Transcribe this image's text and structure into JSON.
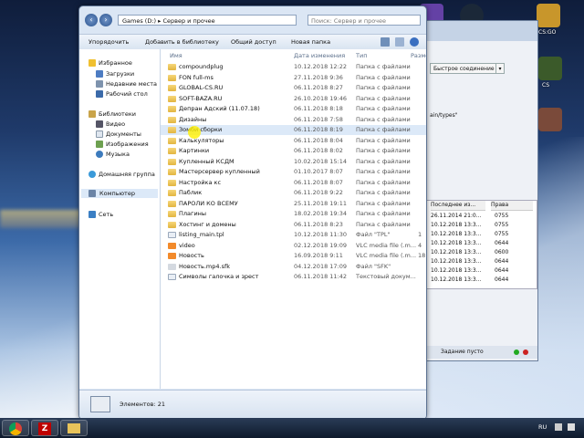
{
  "desktop": {
    "top_icons": [
      "twitch",
      "steam",
      "csgo"
    ],
    "icon_labels": [
      "CS:GO",
      "CS"
    ]
  },
  "explorer": {
    "breadcrumb": [
      "Games (D:)",
      "Сервер и прочее"
    ],
    "search_placeholder": "Поиск: Сервер и прочее",
    "toolbar": {
      "organize": "Упорядочить",
      "add_library": "Добавить в библиотеку",
      "share": "Общий доступ",
      "new_folder": "Новая папка"
    },
    "nav": {
      "favorites": "Избранное",
      "downloads": "Загрузки",
      "recent": "Недавние места",
      "desktop": "Рабочий стол",
      "libraries": "Библиотеки",
      "video": "Видео",
      "documents": "Документы",
      "images": "Изображения",
      "music": "Музыка",
      "homegroup": "Домашняя группа",
      "computer": "Компьютер",
      "network": "Сеть"
    },
    "columns": {
      "name": "Имя",
      "date": "Дата изменения",
      "type": "Тип",
      "size": "Размер"
    },
    "files": [
      {
        "name": "compoundplug",
        "date": "10.12.2018 12:22",
        "type": "Папка с файлами",
        "kind": "folder"
      },
      {
        "name": "FON full-ms",
        "date": "27.11.2018 9:36",
        "type": "Папка с файлами",
        "kind": "folder"
      },
      {
        "name": "GLOBAL-CS.RU",
        "date": "06.11.2018 8:27",
        "type": "Папка с файлами",
        "kind": "folder"
      },
      {
        "name": "SOFT-BAZA.RU",
        "date": "26.10.2018 19:46",
        "type": "Папка с файлами",
        "kind": "folder"
      },
      {
        "name": "Депран Адский (11.07.18)",
        "date": "06.11.2018 8:18",
        "type": "Папка с файлами",
        "kind": "folder"
      },
      {
        "name": "Дизайны",
        "date": "06.11.2018 7:58",
        "type": "Папка с файлами",
        "kind": "folder"
      },
      {
        "name": "Зомби сборки",
        "date": "06.11.2018 8:19",
        "type": "Папка с файлами",
        "kind": "folder",
        "selected": true
      },
      {
        "name": "Калькуляторы",
        "date": "06.11.2018 8:04",
        "type": "Папка с файлами",
        "kind": "folder"
      },
      {
        "name": "Картинки",
        "date": "06.11.2018 8:02",
        "type": "Папка с файлами",
        "kind": "folder"
      },
      {
        "name": "Купленный КСДМ",
        "date": "10.02.2018 15:14",
        "type": "Папка с файлами",
        "kind": "folder"
      },
      {
        "name": "Мастерсервер купленный",
        "date": "01.10.2017 8:07",
        "type": "Папка с файлами",
        "kind": "folder"
      },
      {
        "name": "Настройка кс",
        "date": "06.11.2018 8:07",
        "type": "Папка с файлами",
        "kind": "folder"
      },
      {
        "name": "Паблик",
        "date": "06.11.2018 9:22",
        "type": "Папка с файлами",
        "kind": "folder"
      },
      {
        "name": "ПАРОЛИ КО ВСЕМУ",
        "date": "25.11.2018 19:11",
        "type": "Папка с файлами",
        "kind": "folder"
      },
      {
        "name": "Плагины",
        "date": "18.02.2018 19:34",
        "type": "Папка с файлами",
        "kind": "folder"
      },
      {
        "name": "Хостинг и домены",
        "date": "06.11.2018 8:23",
        "type": "Папка с файлами",
        "kind": "folder"
      },
      {
        "name": "listing_main.tpl",
        "date": "10.12.2018 11:30",
        "type": "Файл \"TPL\"",
        "size": "1",
        "kind": "file"
      },
      {
        "name": "video",
        "date": "02.12.2018 19:09",
        "type": "VLC media file (.m...",
        "size": "4",
        "kind": "video"
      },
      {
        "name": "Новость",
        "date": "16.09.2018 9:11",
        "type": "VLC media file (.m...",
        "size": "18",
        "kind": "video"
      },
      {
        "name": "Новость.mp4.sfk",
        "date": "04.12.2018 17:09",
        "type": "Файл \"SFK\"",
        "kind": "sfk"
      },
      {
        "name": "Символы галочка и зрест",
        "date": "06.11.2018 11:42",
        "type": "Текстовый докум...",
        "kind": "file"
      }
    ],
    "status_count": "Элементов: 21"
  },
  "filezilla": {
    "quick_connect": "Быстрое соединение",
    "path_text": "ain/types\"",
    "columns": {
      "modified": "Последнее из...",
      "perm": "Права"
    },
    "rows": [
      {
        "modified": "26.11.2014 21:0...",
        "perm": "0755"
      },
      {
        "modified": "10.12.2018 13:3...",
        "perm": "0755"
      },
      {
        "modified": "10.12.2018 13:3...",
        "perm": "0755"
      },
      {
        "modified": "10.12.2018 13:3...",
        "perm": "0644"
      },
      {
        "modified": "10.12.2018 13:3...",
        "perm": "0600"
      },
      {
        "modified": "10.12.2018 13:3...",
        "perm": "0644"
      },
      {
        "modified": "10.12.2018 13:3...",
        "perm": "0644"
      },
      {
        "modified": "10.12.2018 13:3...",
        "perm": "0644"
      }
    ],
    "queue_status": "Задание пусто"
  },
  "taskbar": {
    "apps": [
      "chrome",
      "filezilla",
      "explorer"
    ],
    "lang": "RU"
  }
}
